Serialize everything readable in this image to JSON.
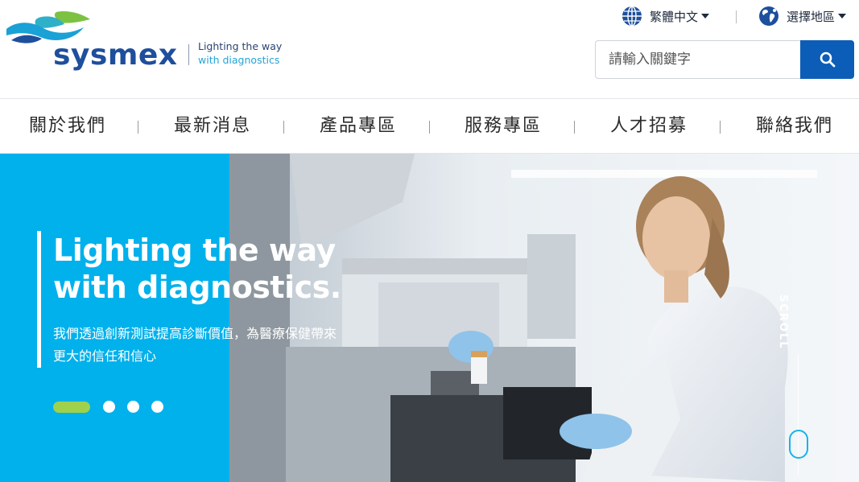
{
  "brand": {
    "name": "sysmex",
    "tagline_line1": "Lighting the way",
    "tagline_line2": "with diagnostics",
    "colors": {
      "navy": "#1e4f9c",
      "teal": "#25a4d6",
      "green": "#7cc242"
    }
  },
  "utility": {
    "language_label": "繁體中文",
    "language_icon": "globe-icon",
    "region_label": "選擇地區",
    "region_icon": "world-map-icon"
  },
  "search": {
    "placeholder": "請輸入關鍵字",
    "value": "",
    "button_icon": "search-icon",
    "button_color": "#0b5db8"
  },
  "nav": {
    "items": [
      {
        "label": "關於我們"
      },
      {
        "label": "最新消息"
      },
      {
        "label": "產品專區"
      },
      {
        "label": "服務專區"
      },
      {
        "label": "人才招募"
      },
      {
        "label": "聯絡我們"
      }
    ]
  },
  "hero": {
    "title_line1": "Lighting the way",
    "title_line2": "with diagnostics.",
    "subtitle_line1": "我們透過創新測試提高診斷價值，為醫療保健帶來",
    "subtitle_line2": "更大的信任和信心",
    "accent_color": "#00b1ec",
    "slides_total": 4,
    "slide_active": 1,
    "scroll_label": "SCROLL"
  }
}
